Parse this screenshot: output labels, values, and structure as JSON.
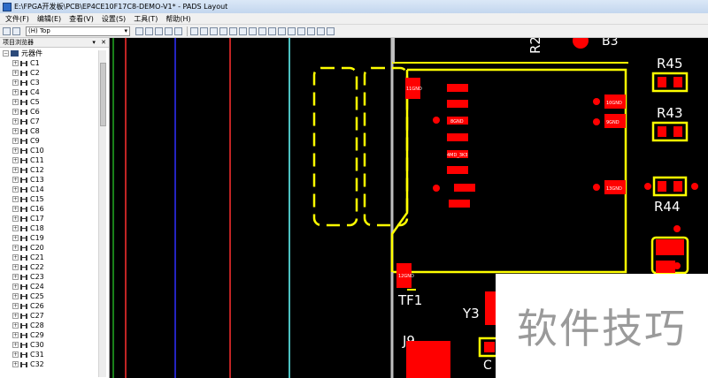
{
  "window": {
    "title": "E:\\FPGA开发板\\PCB\\EP4CE10F17C8-DEMO-V1* - PADS Layout"
  },
  "menu": [
    "文件(F)",
    "编辑(E)",
    "查看(V)",
    "设置(S)",
    "工具(T)",
    "帮助(H)"
  ],
  "toolbar": {
    "layer_value": "(H) Top"
  },
  "panel": {
    "title": "项目浏览器",
    "root_label": "元器件",
    "items": [
      "C1",
      "C2",
      "C3",
      "C4",
      "C5",
      "C6",
      "C7",
      "C8",
      "C9",
      "C10",
      "C11",
      "C12",
      "C13",
      "C14",
      "C15",
      "C16",
      "C17",
      "C18",
      "C19",
      "C20",
      "C21",
      "C22",
      "C23",
      "C24",
      "C25",
      "C26",
      "C27",
      "C28",
      "C29",
      "C30",
      "C31",
      "C32"
    ]
  },
  "canvas": {
    "refdes": {
      "r45": "R45",
      "r43": "R43",
      "r44": "R44",
      "r2x": "R2",
      "tf1": "TF1",
      "y3": "Y3",
      "j9": "J9",
      "c_partial": "C"
    },
    "pads": {
      "p11": "11GND",
      "p8": "8GND",
      "p4": "4MD_3K3",
      "p10": "10GND",
      "p9": "9GND",
      "p13": "13GND",
      "p12": "12GND"
    },
    "colors": {
      "silkscreen": "#ffff00",
      "copper": "#ff0000",
      "board_line": "#c0c0c0",
      "guide_red": "#ff3030",
      "guide_blue": "#3030ff",
      "guide_cyan": "#66ffff"
    }
  },
  "watermark": {
    "text": "软件技巧"
  }
}
